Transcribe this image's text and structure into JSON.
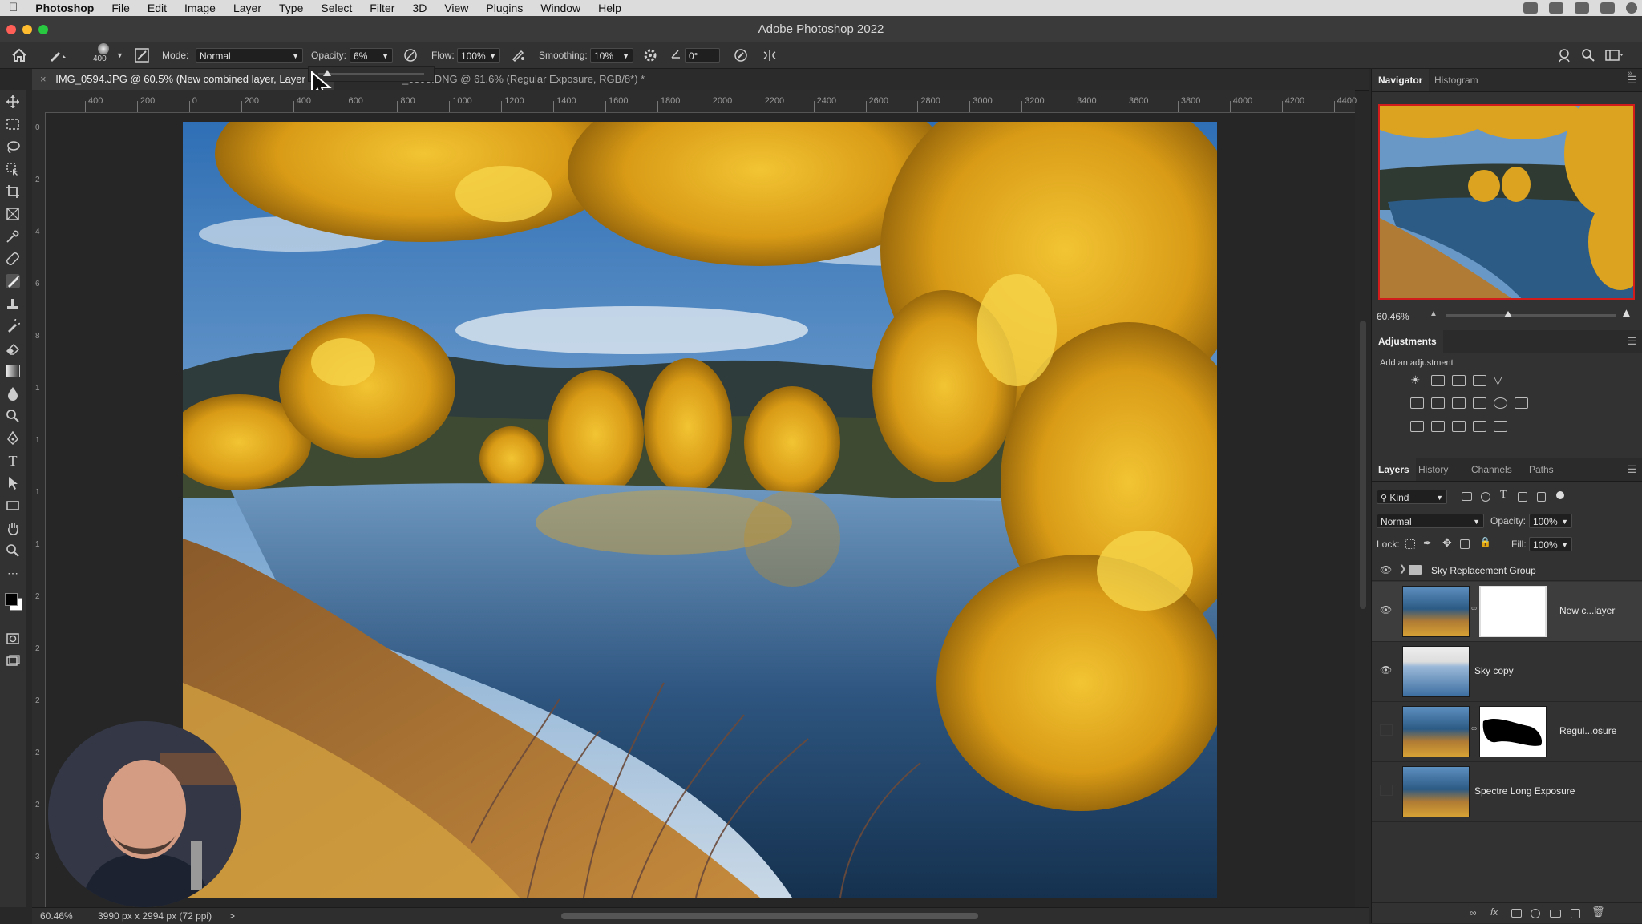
{
  "menubar": {
    "apple_icon": "apple-icon",
    "app_name": "Photoshop",
    "items": [
      "File",
      "Edit",
      "Image",
      "Layer",
      "Type",
      "Select",
      "Filter",
      "3D",
      "View",
      "Plugins",
      "Window",
      "Help"
    ]
  },
  "window": {
    "title": "Adobe Photoshop 2022"
  },
  "options": {
    "brush_size": "400",
    "mode_label": "Mode:",
    "mode_value": "Normal",
    "opacity_label": "Opacity:",
    "opacity_value": "6%",
    "flow_label": "Flow:",
    "flow_value": "100%",
    "smoothing_label": "Smoothing:",
    "smoothing_value": "10%",
    "angle_value": "0°"
  },
  "tabs": {
    "active": "IMG_0594.JPG @ 60.5% (New combined layer, Layer",
    "second": "_0595.DNG @ 61.6% (Regular Exposure, RGB/8*) *"
  },
  "ruler": {
    "h_ticks": [
      "400",
      "200",
      "0",
      "200",
      "400",
      "600",
      "800",
      "1000",
      "1200",
      "1400",
      "1600",
      "1800",
      "2000",
      "2200",
      "2400",
      "2600",
      "2800",
      "3000",
      "3200",
      "3400",
      "3600",
      "3800",
      "4000",
      "4200",
      "4400"
    ],
    "v_ticks": [
      "0",
      "2",
      "4",
      "6",
      "8",
      "1",
      "1",
      "1",
      "1",
      "2",
      "2",
      "2",
      "2",
      "2",
      "3"
    ]
  },
  "status": {
    "zoom": "60.46%",
    "doc_info": "3990 px x 2994 px (72 ppi)",
    "arrow": ">"
  },
  "navigator": {
    "tabs": [
      "Navigator",
      "Histogram"
    ],
    "zoom": "60.46%",
    "zoom_fraction": 0.37
  },
  "adjustments": {
    "title": "Adjustments",
    "add_label": "Add an adjustment"
  },
  "layers": {
    "tabs": [
      "Layers",
      "History",
      "Channels",
      "Paths"
    ],
    "kind_label": "Kind",
    "blend_mode": "Normal",
    "opacity_label": "Opacity:",
    "opacity_value": "100%",
    "lock_label": "Lock:",
    "fill_label": "Fill:",
    "fill_value": "100%",
    "group_name": "Sky Replacement Group",
    "items": [
      {
        "name": "New c...layer"
      },
      {
        "name": "Sky copy"
      },
      {
        "name": "Regul...osure"
      },
      {
        "name": "Spectre Long Exposure"
      }
    ]
  }
}
